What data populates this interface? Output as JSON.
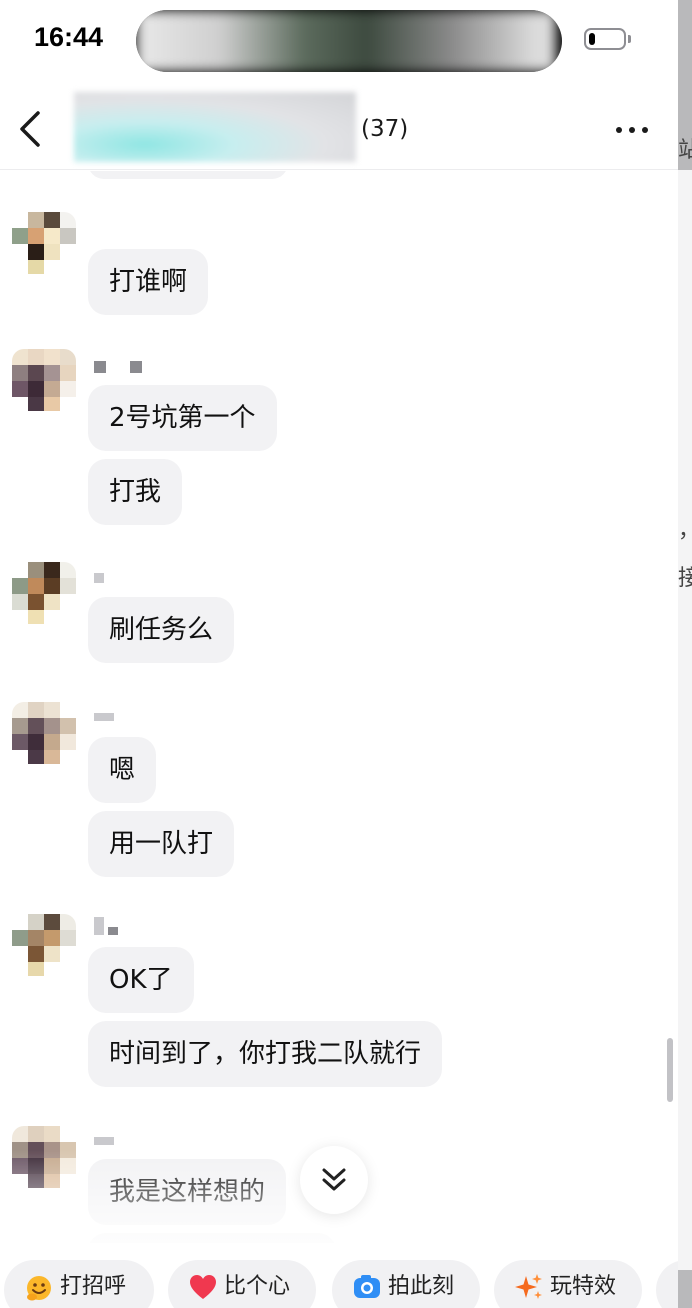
{
  "status_bar": {
    "time": "16:44",
    "battery_level": 0.2
  },
  "header": {
    "member_count": "(37)"
  },
  "messages": [
    {
      "id": "m1",
      "bubbles": [
        "打谁啊"
      ]
    },
    {
      "id": "m2",
      "bubbles": [
        "2号坑第一个",
        "打我"
      ]
    },
    {
      "id": "m3",
      "bubbles": [
        "刷任务么"
      ]
    },
    {
      "id": "m4",
      "bubbles": [
        "嗯",
        "用一队打"
      ]
    },
    {
      "id": "m5",
      "bubbles": [
        "OK了",
        "时间到了，你打我二队就行"
      ]
    },
    {
      "id": "m6",
      "bubbles": [
        "我是这样想的"
      ]
    }
  ],
  "quick_actions": [
    {
      "label": "打招呼",
      "icon": "smile-wave-icon"
    },
    {
      "label": "比个心",
      "icon": "heart-icon"
    },
    {
      "label": "拍此刻",
      "icon": "camera-icon"
    },
    {
      "label": "玩特效",
      "icon": "sparkle-icon"
    }
  ],
  "background_edge_text": [
    "站",
    "，",
    "接"
  ],
  "colors": {
    "bubble_bg": "#f2f2f4",
    "heart": "#f0384f",
    "camera": "#2f8ef5",
    "sparkle": "#f56a1e",
    "smile": "#fbb72a"
  }
}
